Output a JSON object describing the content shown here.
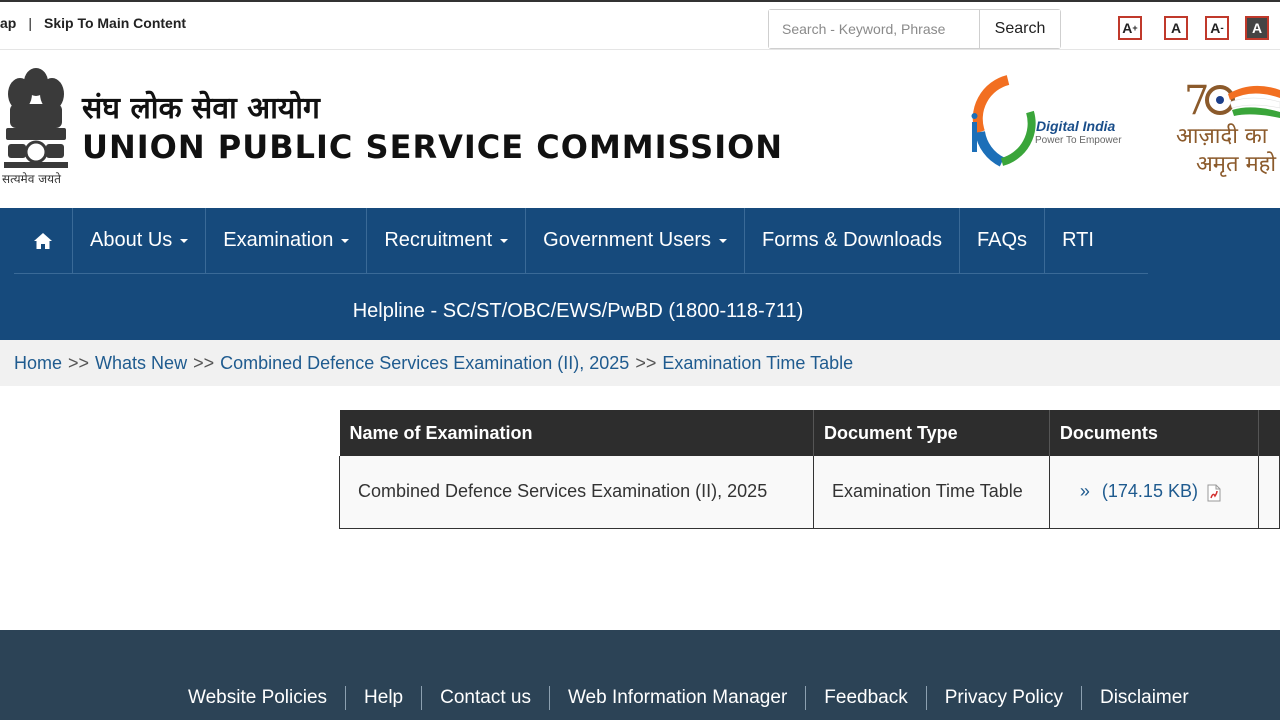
{
  "topbar": {
    "sitemap_fragment": "ap",
    "separator": "|",
    "skip_link": "Skip To Main Content",
    "search_placeholder": "Search - Keyword, Phrase",
    "search_button": "Search",
    "font_controls": [
      "A+",
      "A",
      "A-",
      "A"
    ]
  },
  "header": {
    "title_hindi": "संघ लोक सेवा आयोग",
    "title_english": "UNION PUBLIC SERVICE COMMISSION",
    "motto": "सत्यमेव जयते",
    "digital_india": "Digital India",
    "digital_india_tagline": "Power To Empower",
    "aka_line1": "आज़ादी का",
    "aka_line2": "अमृत महो"
  },
  "nav": {
    "items": [
      {
        "label": "About Us",
        "dropdown": true
      },
      {
        "label": "Examination",
        "dropdown": true
      },
      {
        "label": "Recruitment",
        "dropdown": true
      },
      {
        "label": "Government Users",
        "dropdown": true
      },
      {
        "label": "Forms & Downloads",
        "dropdown": false
      },
      {
        "label": "FAQs",
        "dropdown": false
      },
      {
        "label": "RTI",
        "dropdown": false
      }
    ],
    "helpline": "Helpline - SC/ST/OBC/EWS/PwBD (1800-118-711)"
  },
  "breadcrumb": {
    "items": [
      "Home",
      "Whats New",
      "Combined Defence Services Examination (II), 2025",
      "Examination Time Table"
    ],
    "separator": ">>"
  },
  "table": {
    "headers": [
      "Name of Examination",
      "Document Type",
      "Documents"
    ],
    "rows": [
      {
        "name": "Combined Defence Services Examination (II), 2025",
        "doc_type": "Examination Time Table",
        "bullet": "»",
        "size": "(174.15 KB)"
      }
    ]
  },
  "footer": {
    "links": [
      "Website Policies",
      "Help",
      "Contact us",
      "Web Information Manager",
      "Feedback",
      "Privacy Policy",
      "Disclaimer"
    ]
  },
  "colors": {
    "nav_bg": "#164a7c",
    "footer_bg": "#2c4356",
    "link": "#1f5b8f",
    "table_header": "#2d2d2d"
  }
}
